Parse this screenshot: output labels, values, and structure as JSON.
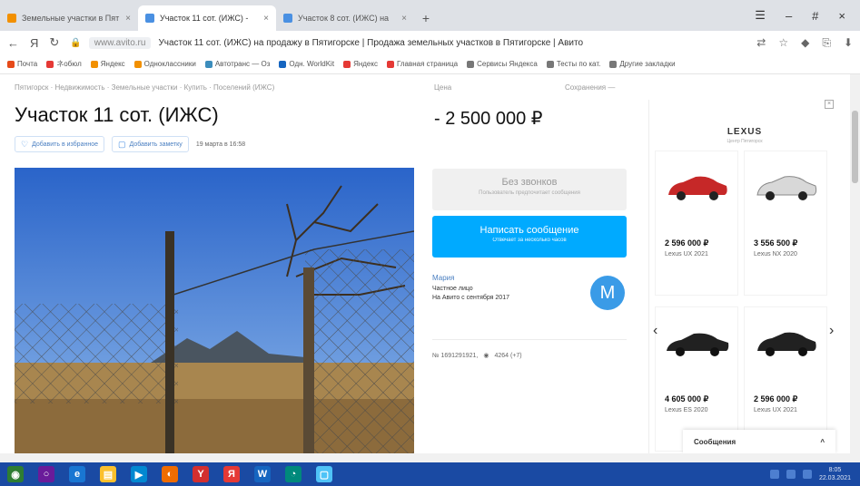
{
  "browser": {
    "tabs": [
      {
        "title": "Земельные участки в Пят",
        "active": false,
        "color": "#f29000"
      },
      {
        "title": "Участок 11 сот. (ИЖС) -",
        "active": true,
        "color": "#4a90e2"
      },
      {
        "title": "Участок 8 сот. (ИЖС) на",
        "active": false,
        "color": "#4a90e2"
      }
    ],
    "new_tab": "+",
    "window_controls": {
      "minimize": "–",
      "maximize": "#",
      "close": "×"
    },
    "nav": {
      "back": "←",
      "yandex": "Я",
      "reload": "↻"
    },
    "url_domain": "www.avito.ru",
    "page_title": "Участок 11 сот. (ИЖС) на продажу в Пятигорске | Продажа земельных участков в Пятигорске | Авито",
    "bookmarks": [
      {
        "label": "Почта",
        "color": "#e64a19"
      },
      {
        "label": "ネобюл",
        "color": "#e53935"
      },
      {
        "label": "Яндекс",
        "color": "#f29000"
      },
      {
        "label": "Одноклассники",
        "color": "#f29000"
      },
      {
        "label": "Автотранс — Оз",
        "color": "#3c8dbc"
      },
      {
        "label": "Одн. WorldKit",
        "color": "#1565c0"
      },
      {
        "label": "Яндекс",
        "color": "#e53935"
      },
      {
        "label": "Главная страница",
        "color": "#e53935"
      },
      {
        "label": "Сервисы Яндекса",
        "color": "#777777"
      },
      {
        "label": "Тесты по кат.",
        "color": "#777777"
      },
      {
        "label": "Другие закладки",
        "color": "#777777"
      }
    ]
  },
  "listing": {
    "breadcrumbs": "Пятигорск · Недвижимость · Земельные участки · Купить · Поселений (ИЖС)",
    "price_label": "Цена",
    "compare": "Сохранения —",
    "title": "Участок 11 сот. (ИЖС)",
    "price": "- 2 500 000 ₽",
    "favorite_label": "Добавить в избранное",
    "note_label": "Добавить заметку",
    "date": "19 марта в 16:58",
    "no_calls_title": "Без звонков",
    "no_calls_sub": "Пользователь предпочитает сообщения",
    "message_button": "Написать сообщение",
    "message_sub": "Отвечает за несколько часов",
    "seller_name": "Мария",
    "seller_type": "Частное лицо",
    "seller_since": "На Авито с сентября 2017",
    "avatar_letter": "М",
    "ad_number": "№ 1691291921,",
    "views": "4264 (+7)"
  },
  "ad": {
    "brand": "LEXUS",
    "brand_sub": "Центр Пятигорск",
    "close": "×",
    "cards": [
      {
        "price": "2 596 000 ₽",
        "model": "Lexus UX 2021",
        "color": "#c62828"
      },
      {
        "price": "3 556 500 ₽",
        "model": "Lexus NX 2020",
        "color": "#e0e0e0"
      },
      {
        "price": "4 605 000 ₽",
        "model": "Lexus ES 2020",
        "color": "#212121"
      },
      {
        "price": "2 596 000 ₽",
        "model": "Lexus UX 2021",
        "color": "#212121"
      }
    ],
    "prev": "‹",
    "next": "›"
  },
  "messages_bar": {
    "label": "Сообщения",
    "chevron": "^"
  },
  "taskbar": {
    "icons": [
      {
        "name": "start-icon",
        "glyph": "◉",
        "color": "#2e7d32"
      },
      {
        "name": "cortana-icon",
        "glyph": "○",
        "color": "#6a1b9a"
      },
      {
        "name": "ie-icon",
        "glyph": "e",
        "color": "#1976d2"
      },
      {
        "name": "explorer-icon",
        "glyph": "▤",
        "color": "#fbc02d"
      },
      {
        "name": "media-icon",
        "glyph": "▶",
        "color": "#0288d1"
      },
      {
        "name": "firefox-icon",
        "glyph": "◐",
        "color": "#ef6c00"
      },
      {
        "name": "yandex-icon",
        "glyph": "Y",
        "color": "#d32f2f"
      },
      {
        "name": "yandex-browser-icon",
        "glyph": "Я",
        "color": "#e53935"
      },
      {
        "name": "word-icon",
        "glyph": "W",
        "color": "#1565c0"
      },
      {
        "name": "app-icon",
        "glyph": "◔",
        "color": "#00897b"
      },
      {
        "name": "window-icon",
        "glyph": "▢",
        "color": "#4fc3f7"
      }
    ],
    "time": "8:05",
    "date": "22.03.2021"
  }
}
